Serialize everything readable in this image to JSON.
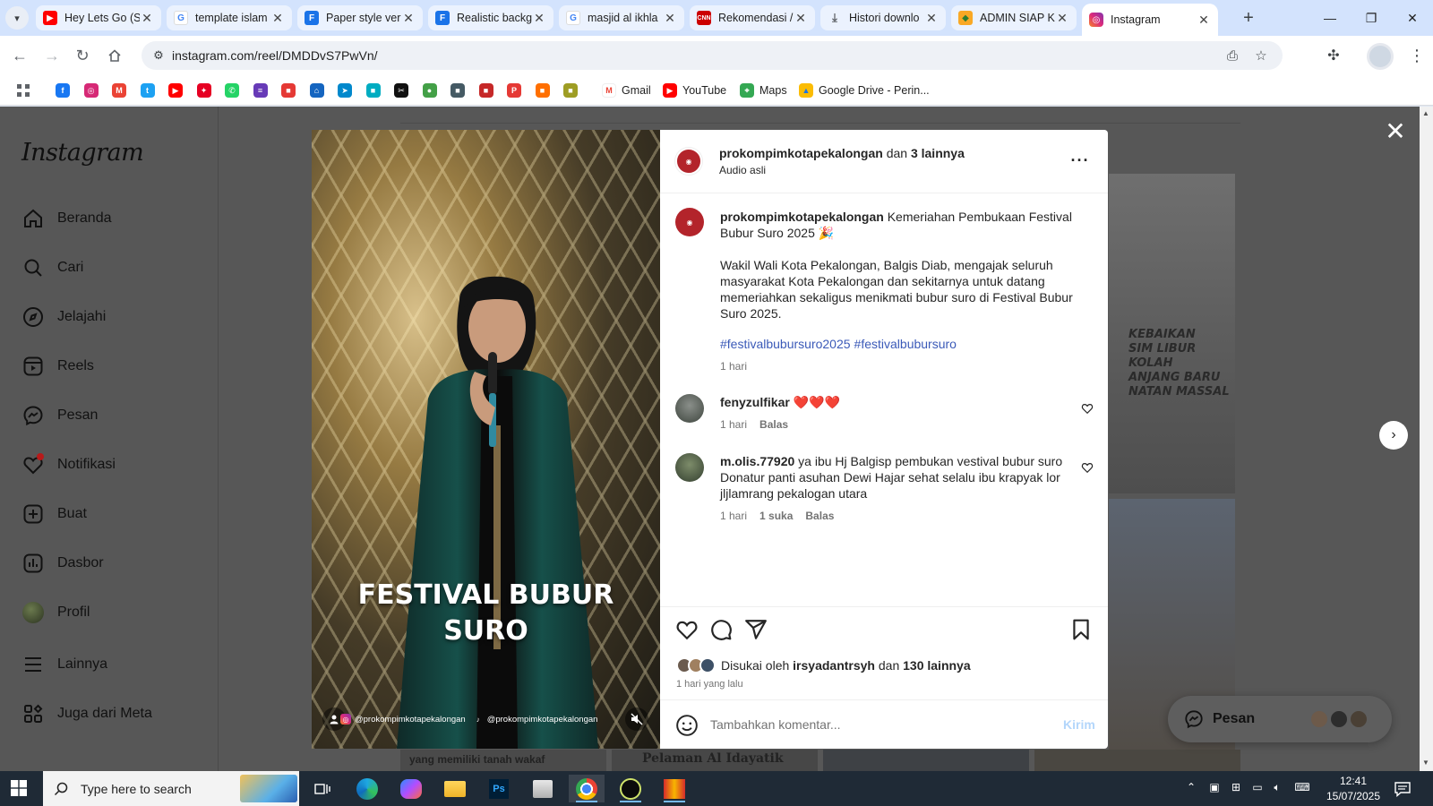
{
  "browser": {
    "tabs": [
      {
        "title": "Hey Lets Go (S",
        "icon": "youtube-icon",
        "color": "#ff0000"
      },
      {
        "title": "template islam",
        "icon": "google-icon",
        "color": "#4285f4"
      },
      {
        "title": "Paper style ver",
        "icon": "docs-icon",
        "color": "#1a73e8"
      },
      {
        "title": "Realistic backg",
        "icon": "docs-icon",
        "color": "#1a73e8"
      },
      {
        "title": "masjid al ikhla",
        "icon": "google-icon",
        "color": "#4285f4"
      },
      {
        "title": "Rekomendasi /",
        "icon": "cnn-icon",
        "color": "#cc0000"
      },
      {
        "title": "Histori downlo",
        "icon": "download-icon",
        "color": "#5f6368"
      },
      {
        "title": "ADMIN SIAP K",
        "icon": "badge-icon",
        "color": "#2e7d32"
      },
      {
        "title": "Instagram",
        "icon": "instagram-icon",
        "color": "#d62976"
      }
    ],
    "url": "instagram.com/reel/DMDDvS7PwVn/",
    "bookmarks": [
      {
        "label": "",
        "icon": "facebook-icon",
        "color": "#1877f2"
      },
      {
        "label": "",
        "icon": "instagram-icon",
        "color": "#d62976"
      },
      {
        "label": "",
        "icon": "gmail-icon",
        "color": "#ea4335"
      },
      {
        "label": "",
        "icon": "twitter-icon",
        "color": "#1da1f2"
      },
      {
        "label": "",
        "icon": "youtube-icon",
        "color": "#ff0000"
      },
      {
        "label": "",
        "icon": "pin-icon",
        "color": "#e60023"
      },
      {
        "label": "",
        "icon": "whatsapp-icon",
        "color": "#25d366"
      },
      {
        "label": "",
        "icon": "forms-icon",
        "color": "#673ab7"
      },
      {
        "label": "",
        "icon": "app-icon",
        "color": "#e53935"
      },
      {
        "label": "",
        "icon": "bank-icon",
        "color": "#1565c0"
      },
      {
        "label": "",
        "icon": "telegram-icon",
        "color": "#0088cc"
      },
      {
        "label": "",
        "icon": "app-icon",
        "color": "#00acc1"
      },
      {
        "label": "",
        "icon": "capcut-icon",
        "color": "#111111"
      },
      {
        "label": "",
        "icon": "chat-icon",
        "color": "#43a047"
      },
      {
        "label": "",
        "icon": "app-icon",
        "color": "#455a64"
      },
      {
        "label": "",
        "icon": "app-icon",
        "color": "#c62828"
      },
      {
        "label": "",
        "icon": "pdf-icon",
        "color": "#e53935"
      },
      {
        "label": "",
        "icon": "app-icon",
        "color": "#ff6f00"
      },
      {
        "label": "",
        "icon": "app-icon",
        "color": "#9e9d24"
      },
      {
        "label": "Gmail",
        "icon": "gmail-icon",
        "color": "#ea4335"
      },
      {
        "label": "YouTube",
        "icon": "youtube-icon",
        "color": "#ff0000"
      },
      {
        "label": "Maps",
        "icon": "maps-icon",
        "color": "#34a853"
      },
      {
        "label": "Google Drive - Perin...",
        "icon": "drive-icon",
        "color": "#fbbc04"
      }
    ]
  },
  "sidebar": {
    "logo": "Instagram",
    "items": [
      {
        "label": "Beranda",
        "icon": "home-icon"
      },
      {
        "label": "Cari",
        "icon": "search-icon"
      },
      {
        "label": "Jelajahi",
        "icon": "explore-icon"
      },
      {
        "label": "Reels",
        "icon": "reels-icon"
      },
      {
        "label": "Pesan",
        "icon": "messenger-icon"
      },
      {
        "label": "Notifikasi",
        "icon": "heart-icon"
      },
      {
        "label": "Buat",
        "icon": "create-icon"
      },
      {
        "label": "Dasbor",
        "icon": "dashboard-icon"
      },
      {
        "label": "Profil",
        "icon": "avatar-icon"
      },
      {
        "label": "Lainnya",
        "icon": "menu-icon"
      },
      {
        "label": "Juga dari Meta",
        "icon": "meta-icon"
      }
    ]
  },
  "video": {
    "overlay_title_line1": "FESTIVAL BUBUR",
    "overlay_title_line2": "SURO",
    "handle_instagram": "@prokompimkotapekalongan",
    "handle_tiktok": "@prokompimkotapekalongan"
  },
  "post": {
    "header": {
      "username": "prokompimkotapekalongan",
      "joiner": " dan ",
      "others": "3 lainnya",
      "audio": "Audio asli"
    },
    "caption": {
      "username": "prokompimkotapekalongan",
      "title": "Kemeriahan Pembukaan Festival Bubur Suro 2025 🎉",
      "body": "Wakil Wali Kota Pekalongan, Balgis Diab, mengajak seluruh masyarakat Kota Pekalongan dan sekitarnya untuk datang memeriahkan sekaligus menikmati bubur suro di Festival Bubur Suro 2025.",
      "hashtags": [
        "#festivalbubursuro2025",
        "#festivalbubursuro"
      ],
      "time": "1 hari"
    },
    "comments": [
      {
        "username": "fenyzulfikar",
        "text": "❤️❤️❤️",
        "time": "1 hari",
        "likes": "",
        "reply": "Balas"
      },
      {
        "username": "m.olis.77920",
        "text": "ya ibu Hj Balgisp pembukan vestival bubur suro Donatur panti asuhan Dewi Hajar sehat selalu ibu krapyak lor jljlamrang pekalogan utara",
        "time": "1 hari",
        "likes": "1 suka",
        "reply": "Balas"
      }
    ],
    "likes": {
      "prefix": "Disukai oleh ",
      "user": "irsyadantrsyh",
      "joiner": " dan ",
      "others": "130 lainnya"
    },
    "posted": "1 hari yang lalu",
    "add_comment_placeholder": "Tambahkan komentar...",
    "send_label": "Kirim"
  },
  "messages_pill": {
    "label": "Pesan"
  },
  "background_text": {
    "tile1": "KEBAIKAN\nSIM LIBUR\nKOLAH\nANJANG BARU\nNATAN MASSAL",
    "bottom_strip_left": "yang memiliki tanah wakaf",
    "bottom_strip_mid": "Pelaman Al Idayatik"
  },
  "taskbar": {
    "search_placeholder": "Type here to search",
    "time": "12:41",
    "date": "15/07/2025"
  },
  "colors": {
    "instagram_link": "#3b5ab8",
    "dim_overlay": "#575757",
    "avatar_red": "#b3242b",
    "heart_red": "#e0201c"
  }
}
